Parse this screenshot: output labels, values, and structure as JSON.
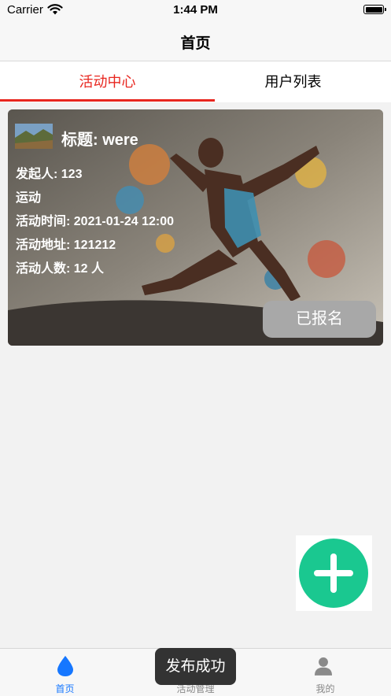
{
  "status_bar": {
    "carrier": "Carrier",
    "time": "1:44 PM"
  },
  "nav": {
    "title": "首页"
  },
  "tabs": [
    {
      "label": "活动中心",
      "active": true
    },
    {
      "label": "用户列表",
      "active": false
    }
  ],
  "activity": {
    "title": "标题: were",
    "organizer": "发起人: 123",
    "type": "运动",
    "time": "活动时间: 2021-01-24 12:00",
    "address": "活动地址: 121212",
    "count": "活动人数: 12 人",
    "button_label": "已报名"
  },
  "bottom_tabs": [
    {
      "label": "首页",
      "icon": "water-drop-icon",
      "active": true
    },
    {
      "label": "活动管理",
      "icon": "activity-icon",
      "active": false
    },
    {
      "label": "我的",
      "icon": "person-icon",
      "active": false
    }
  ],
  "toast": {
    "text": "发布成功"
  },
  "colors": {
    "accent_red": "#e8261f",
    "fab_green": "#1ac890",
    "tab_active_blue": "#1677ff"
  }
}
